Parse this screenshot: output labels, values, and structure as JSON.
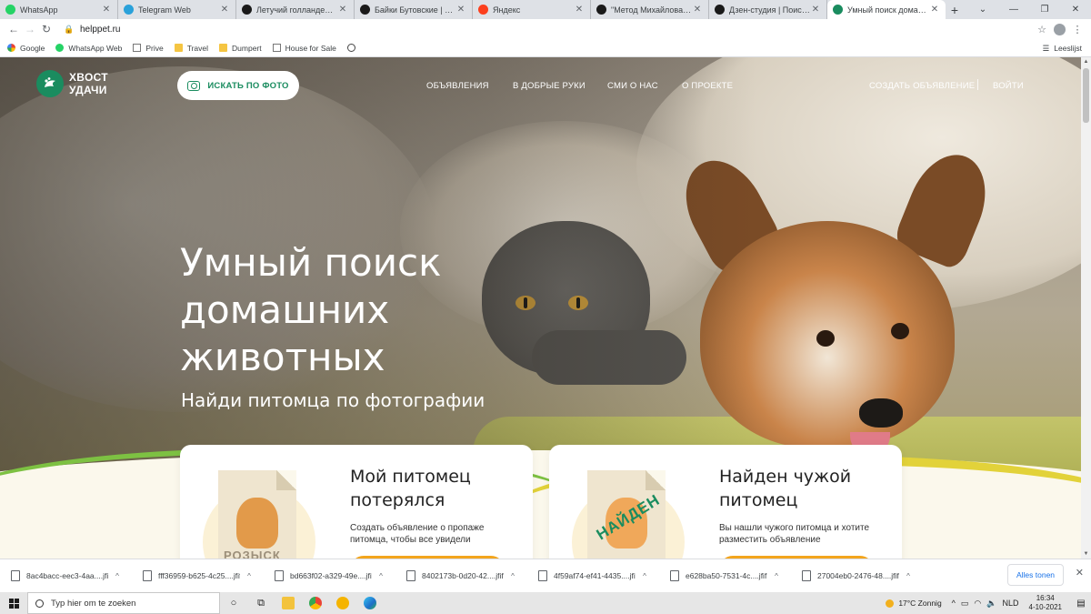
{
  "browser": {
    "tabs": [
      {
        "label": "WhatsApp",
        "favicon_color": "#25d366",
        "active": false
      },
      {
        "label": "Telegram Web",
        "favicon_color": "#2aa1da",
        "active": false
      },
      {
        "label": "Летучий голландец: с про",
        "favicon_color": "#1a1a1a",
        "active": false
      },
      {
        "label": "Байки Бутовские | Яндек",
        "favicon_color": "#1a1a1a",
        "active": false
      },
      {
        "label": "Яндекс",
        "favicon_color": "#fc3f1d",
        "active": false
      },
      {
        "label": "\"Метод Михайлова\". Как",
        "favicon_color": "#1a1a1a",
        "active": false
      },
      {
        "label": "Дзен-студия | Поиск про",
        "favicon_color": "#1a1a1a",
        "active": false
      },
      {
        "label": "Умный поиск домашних ж",
        "favicon_color": "#1a8c5f",
        "active": true
      }
    ],
    "new_tab_icon": "+",
    "url": "helppet.ru",
    "bookmarks": [
      {
        "label": "Google",
        "icon": "google-icon"
      },
      {
        "label": "WhatsApp Web",
        "icon": "whatsapp-icon"
      },
      {
        "label": "Prive",
        "icon": "bookmark-page-icon"
      },
      {
        "label": "Travel",
        "icon": "folder-icon"
      },
      {
        "label": "Dumpert",
        "icon": "folder-icon"
      },
      {
        "label": "House for Sale",
        "icon": "bookmark-page-icon"
      },
      {
        "label": "",
        "icon": "globe-icon"
      }
    ],
    "reading_list": "Leeslijst"
  },
  "site": {
    "brand_color": "#1a8c5f",
    "logo": {
      "line1": "ХВОСТ",
      "line2": "УДАЧИ"
    },
    "photo_search_label": "ИСКАТЬ ПО ФОТО",
    "nav": [
      "ОБЪЯВЛЕНИЯ",
      "В ДОБРЫЕ РУКИ",
      "СМИ О НАС",
      "О ПРОЕКТЕ"
    ],
    "create_ad": "СОЗДАТЬ ОБЪЯВЛЕНИЕ",
    "login": "ВОЙТИ",
    "hero": {
      "title": "Умный поиск домашних животных",
      "subtitle": "Найди питомца по фотографии"
    },
    "cards": [
      {
        "title": "Мой питомец потерялся",
        "description": "Создать объявление о пропаже питомца, чтобы все увидели",
        "stamp": "РОЗЫСК",
        "button_color": "#f3a51d"
      },
      {
        "title": "Найден чужой питомец",
        "description": "Вы нашли чужого питомца и хотите разместить объявление",
        "stamp": "НАЙДЕН",
        "button_color": "#f3a51d"
      }
    ]
  },
  "downloads": {
    "items": [
      "8ac4bacc-eec3-4aa....jfif",
      "fff36959-b625-4c25....jfif",
      "bd663f02-a329-49e....jfif",
      "8402173b-0d20-42....jfif",
      "4f59af74-ef41-4435....jfif",
      "e628ba50-7531-4c....jfif",
      "27004eb0-2476-48....jfif"
    ],
    "show_all": "Alles tonen"
  },
  "taskbar": {
    "search_placeholder": "Typ hier om te zoeken",
    "weather": "17°C  Zonnig",
    "language": "NLD",
    "time": "16:34",
    "date": "4-10-2021"
  }
}
